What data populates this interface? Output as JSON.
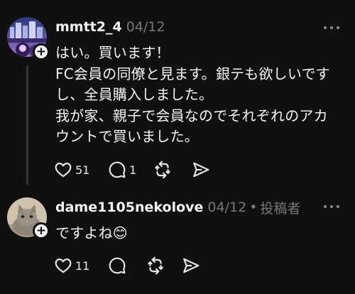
{
  "posts": [
    {
      "username": "mmtt2_4",
      "date": "04/12",
      "author_tag": "",
      "text": "はい。買います！\nFC会員の同僚と見ます。銀テも欲しいです\nし、全員購入しました。\n我が家、親子で会員なのでそれぞれのアカ\nウントで買いました。",
      "likes": "51",
      "replies": "1"
    },
    {
      "username": "dame1105nekolove",
      "date": "04/12",
      "separator": "•",
      "author_tag": "投稿者",
      "text": "ですよね😊",
      "likes": "11",
      "replies": ""
    }
  ],
  "icons": {
    "follow": "plus-icon",
    "more": "more-horizontal-icon",
    "like": "heart-icon",
    "reply": "comment-icon",
    "repost": "repost-icon",
    "share": "send-icon"
  },
  "colors": {
    "background": "#101010",
    "text_primary": "#f3f5f7",
    "text_secondary": "#777777",
    "thread_line": "#333638"
  }
}
